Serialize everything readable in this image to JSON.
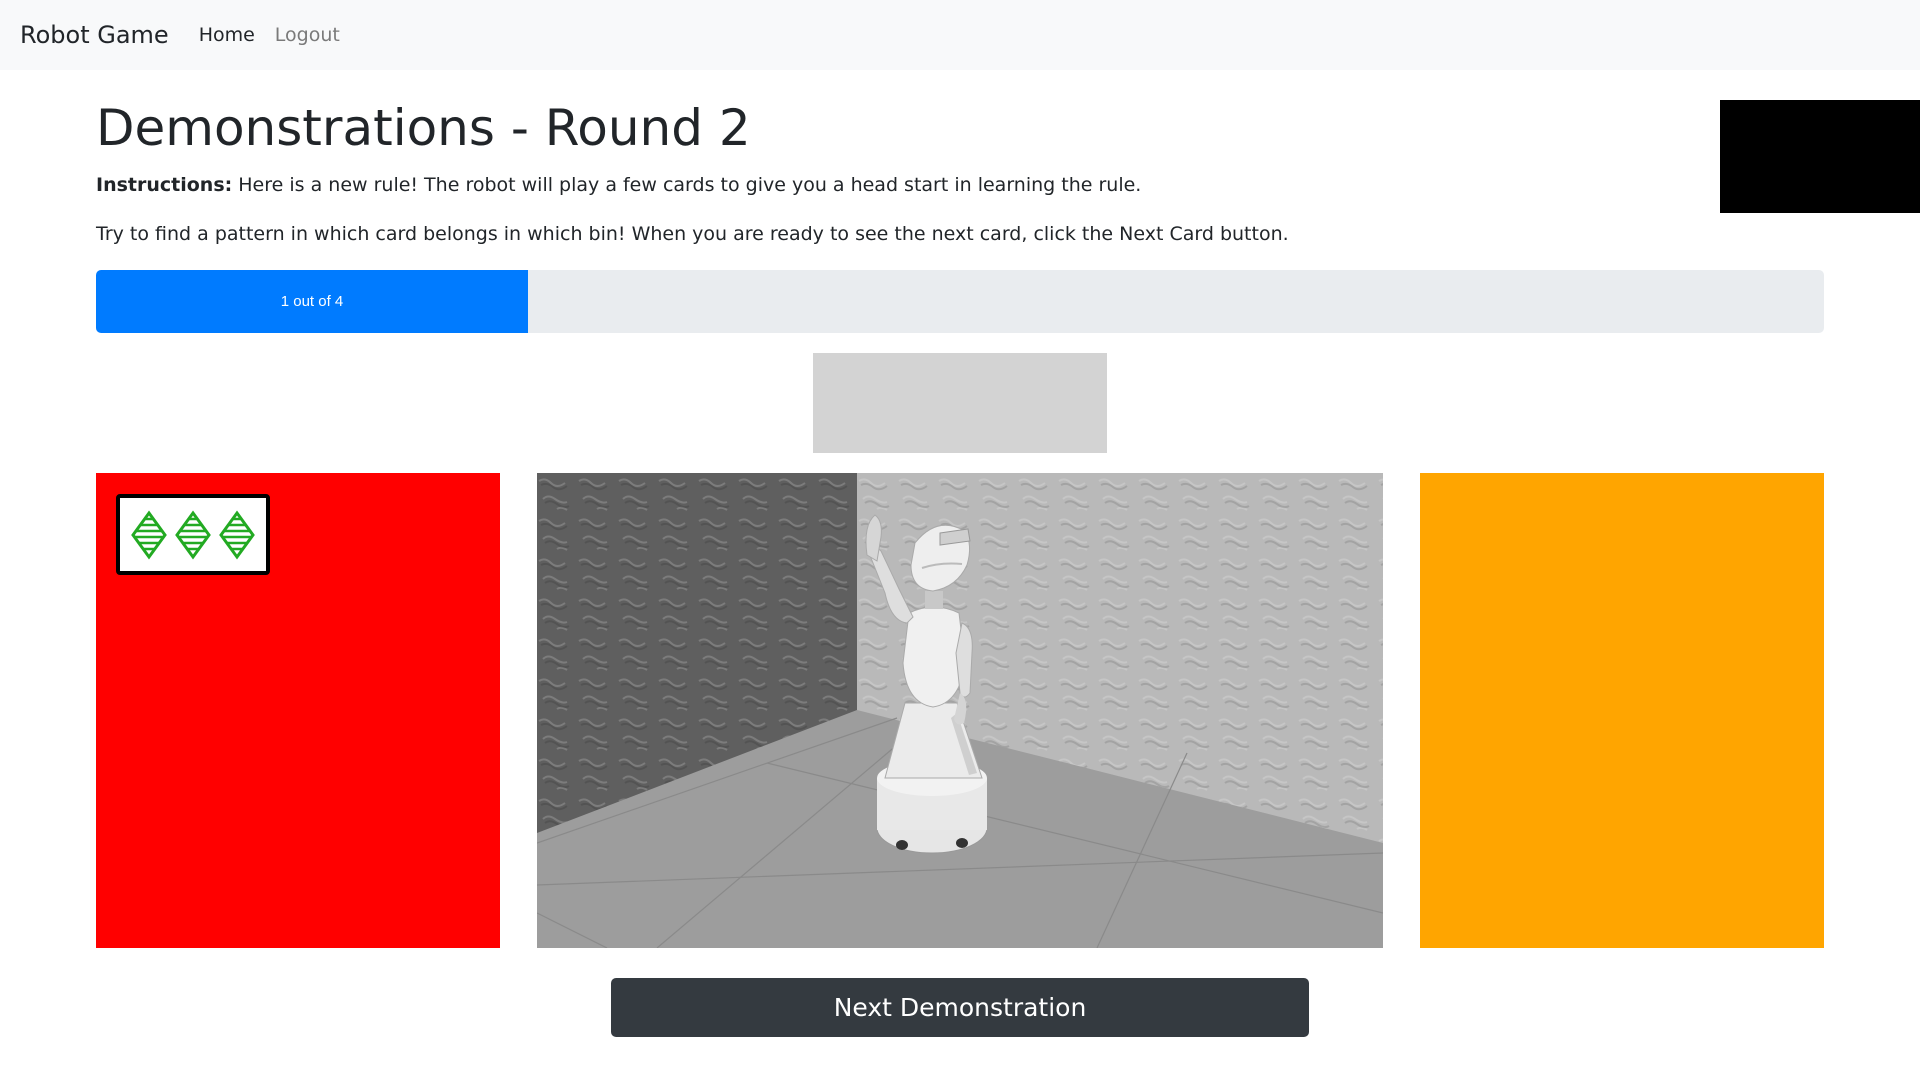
{
  "navbar": {
    "brand": "Robot Game",
    "links": [
      {
        "label": "Home"
      },
      {
        "label": "Logout"
      }
    ]
  },
  "page": {
    "title": "Demonstrations - Round 2",
    "instructions_label": "Instructions:",
    "instructions_text": " Here is a new rule! The robot will play a few cards to give you a head start in learning the rule.",
    "instructions_text2": "Try to find a pattern in which card belongs in which bin! When you are ready to see the next card, click the Next Card button."
  },
  "progress": {
    "label": "1 out of 4",
    "current": 1,
    "total": 4,
    "fraction": 0.25,
    "color": "#007bff"
  },
  "bins": {
    "left": {
      "color": "#ff0000"
    },
    "right": {
      "color": "#ffa500"
    }
  },
  "card": {
    "count": 3,
    "shape": "diamond-icon",
    "shape_color": "#22aa22",
    "fill": "striped"
  },
  "scene": {
    "description_icon": "robot-icon"
  },
  "buttons": {
    "next_label": "Next Demonstration"
  }
}
